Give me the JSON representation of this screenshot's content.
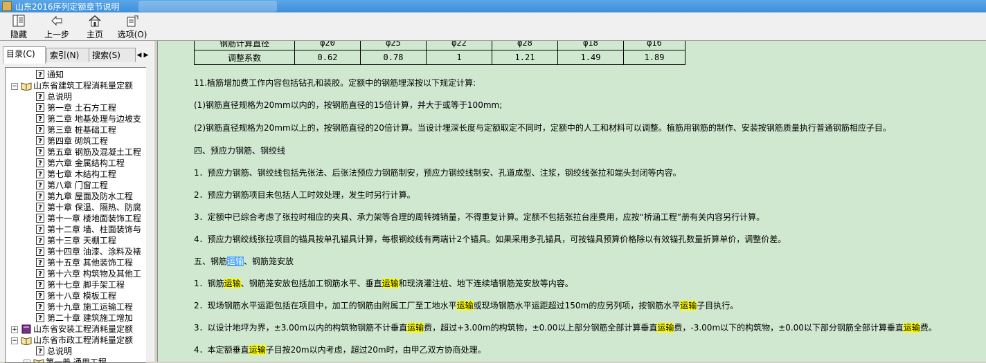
{
  "window": {
    "title": "山东2016序列定额章节说明"
  },
  "toolbar": {
    "hide": "隐藏",
    "back": "上一步",
    "home": "主页",
    "options": "选项(O)"
  },
  "tabs": [
    {
      "label": "目录(C)"
    },
    {
      "label": "索引(N)"
    },
    {
      "label": "搜索(S)"
    }
  ],
  "tree": [
    {
      "label": "通知",
      "icon": "help-page-icon",
      "level": 1
    },
    {
      "label": "山东省建筑工程消耗量定额",
      "icon": "book-open-icon",
      "level": 0,
      "toggle": "⊟"
    },
    {
      "label": "总说明",
      "icon": "help-page-icon",
      "level": 2
    },
    {
      "label": "第一章  土石方工程",
      "icon": "help-page-icon",
      "level": 2
    },
    {
      "label": "第二章  地基处理与边坡支",
      "icon": "help-page-icon",
      "level": 2
    },
    {
      "label": "第三章  桩基础工程",
      "icon": "help-page-icon",
      "level": 2
    },
    {
      "label": "第四章  砌筑工程",
      "icon": "help-page-icon",
      "level": 2
    },
    {
      "label": "第五章  钢筋及混凝土工程",
      "icon": "help-page-icon",
      "level": 2
    },
    {
      "label": "第六章  金属结构工程",
      "icon": "help-page-icon",
      "level": 2
    },
    {
      "label": "第七章  木结构工程",
      "icon": "help-page-icon",
      "level": 2
    },
    {
      "label": "第八章  门窗工程",
      "icon": "help-page-icon",
      "level": 2
    },
    {
      "label": "第九章  屋面及防水工程",
      "icon": "help-page-icon",
      "level": 2
    },
    {
      "label": "第十章  保温、隔热、防腐",
      "icon": "help-page-icon",
      "level": 2
    },
    {
      "label": "第十一章  楼地面装饰工程",
      "icon": "help-page-icon",
      "level": 2
    },
    {
      "label": "第十二章  墙、柱面装饰与",
      "icon": "help-page-icon",
      "level": 2
    },
    {
      "label": "第十三章  天棚工程",
      "icon": "help-page-icon",
      "level": 2
    },
    {
      "label": "第十四章  油漆、涂料及裱",
      "icon": "help-page-icon",
      "level": 2
    },
    {
      "label": "第十五章  其他装饰工程",
      "icon": "help-page-icon",
      "level": 2
    },
    {
      "label": "第十六章  构筑物及其他工",
      "icon": "help-page-icon",
      "level": 2
    },
    {
      "label": "第十七章  脚手架工程",
      "icon": "help-page-icon",
      "level": 2
    },
    {
      "label": "第十八章  模板工程",
      "icon": "help-page-icon",
      "level": 2
    },
    {
      "label": "第十九章  施工运输工程",
      "icon": "help-page-icon",
      "level": 2
    },
    {
      "label": "第二十章  建筑施工增加",
      "icon": "help-page-icon",
      "level": 2
    },
    {
      "label": "山东省安装工程消耗量定额",
      "icon": "book-closed-icon",
      "level": 0,
      "toggle": "⊞"
    },
    {
      "label": "山东省市政工程消耗量定额",
      "icon": "book-open-icon",
      "level": 0,
      "toggle": "⊟"
    },
    {
      "label": "总说明",
      "icon": "help-page-icon",
      "level": 2
    },
    {
      "label": "第一册  通用工程",
      "icon": "book-open-icon",
      "level": 1,
      "toggle": "⊟"
    }
  ],
  "table": {
    "header": [
      "钢筋计算直径",
      "φ20",
      "φ25",
      "φ22",
      "φ28",
      "φ18",
      "φ16"
    ],
    "row": [
      "调整系数",
      "0.62",
      "0.78",
      "1",
      "1.21",
      "1.49",
      "1.89"
    ]
  },
  "paragraphs": [
    [
      {
        "t": "11.植筋增加费工作内容包括钻孔和装胶。定额中的钢筋埋深按以下规定计算:"
      }
    ],
    [
      {
        "t": "(1)钢筋直径规格为20mm以内的，按钢筋直径的15倍计算，并大于或等于100mm;"
      }
    ],
    [
      {
        "t": "(2)钢筋直径规格为20mm以上的，按钢筋直径的20倍计算。当设计埋深长度与定额取定不同时，定额中的人工和材料可以调整。植筋用钢筋的制作、安装按钢筋质量执行普通钢筋相应子目。"
      }
    ],
    [
      {
        "t": "四、预应力钢筋、钢绞线"
      }
    ],
    [
      {
        "t": "1．预应力钢筋、钢绞线包括先张法、后张法预应力钢筋制安，预应力钢绞线制安、孔道成型、注浆，钢绞线张拉和端头封闭等内容。"
      }
    ],
    [
      {
        "t": "2．预应力钢筋项目未包括人工时效处理，发生时另行计算。"
      }
    ],
    [
      {
        "t": "3．定额中已综合考虑了张拉时相应的夹具、承力架等合理的周转摊销量，不得重复计算。定额不包括张拉台座费用，应按“桥涵工程”册有关内容另行计算。"
      }
    ],
    [
      {
        "t": "4．预应力钢绞线张拉项目的锚具按单孔锚具计算，每根钢绞线有两端计2个锚具。如果采用多孔锚具，可按锚具预算价格除以有效锚孔数量折算单价，调整价差。"
      }
    ],
    [
      {
        "t": "五、钢筋"
      },
      {
        "t": "运输",
        "c": "sel"
      },
      {
        "t": "、钢筋笼安放"
      }
    ],
    [
      {
        "t": "1．钢筋"
      },
      {
        "t": "运输",
        "c": "hl"
      },
      {
        "t": "、钢筋笼安放包括加工钢筋水平、垂直"
      },
      {
        "t": "运输",
        "c": "hl"
      },
      {
        "t": "和现浇灌注桩、地下连续墙钢筋笼安放等内容。"
      }
    ],
    [
      {
        "t": "2．现场钢筋水平运距包括在项目中，加工的钢筋由附属工厂至工地水平"
      },
      {
        "t": "运输",
        "c": "hl"
      },
      {
        "t": "或现场钢筋水平运距超过150m的应另列项，按钢筋水平"
      },
      {
        "t": "运输",
        "c": "hl"
      },
      {
        "t": "子目执行。"
      }
    ],
    [
      {
        "t": "3．以设计地坪为界，±3.00m以内的构筑物钢筋不计垂直"
      },
      {
        "t": "运输",
        "c": "hl"
      },
      {
        "t": "费，超过+3.00m的构筑物，±0.00以上部分钢筋全部计算垂直"
      },
      {
        "t": "运输",
        "c": "hl"
      },
      {
        "t": "费，-3.00m以下的构筑物，±0.00以下部分钢筋全部计算垂直"
      },
      {
        "t": "运输",
        "c": "hl"
      },
      {
        "t": "费。"
      }
    ],
    [
      {
        "t": "4．本定额垂直"
      },
      {
        "t": "运输",
        "c": "hl"
      },
      {
        "t": "子目按20m以内考虑，超过20m时，由甲乙双方协商处理。"
      }
    ]
  ]
}
